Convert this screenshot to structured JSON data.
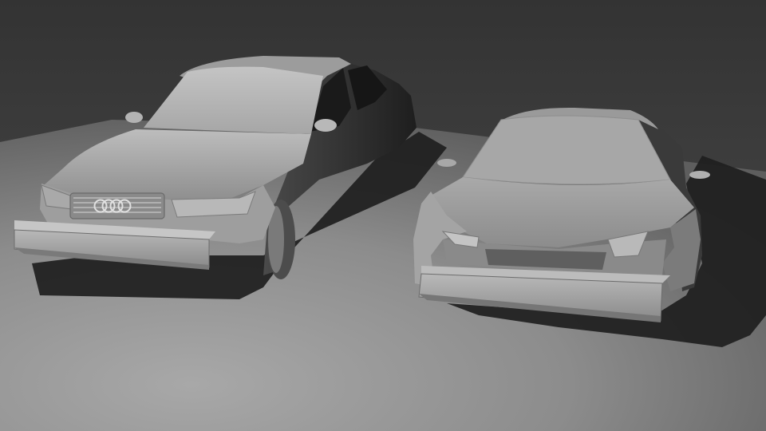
{
  "scene": {
    "description_free": true,
    "objects": [
      {
        "id": "sedan",
        "kind": "car-model",
        "grille_badge": "four-rings-logo"
      },
      {
        "id": "sports-car",
        "kind": "car-model"
      }
    ],
    "colors": {
      "background_top": "#3c3c3c",
      "background_mid": "#474747",
      "floor_light": "#9a9a9a",
      "floor_dark": "#6a6a6a",
      "body_light": "#b5b5b5",
      "body_mid": "#8a8a8a",
      "body_dark": "#2a2a2a",
      "shadow": "#1c1c1c"
    }
  }
}
